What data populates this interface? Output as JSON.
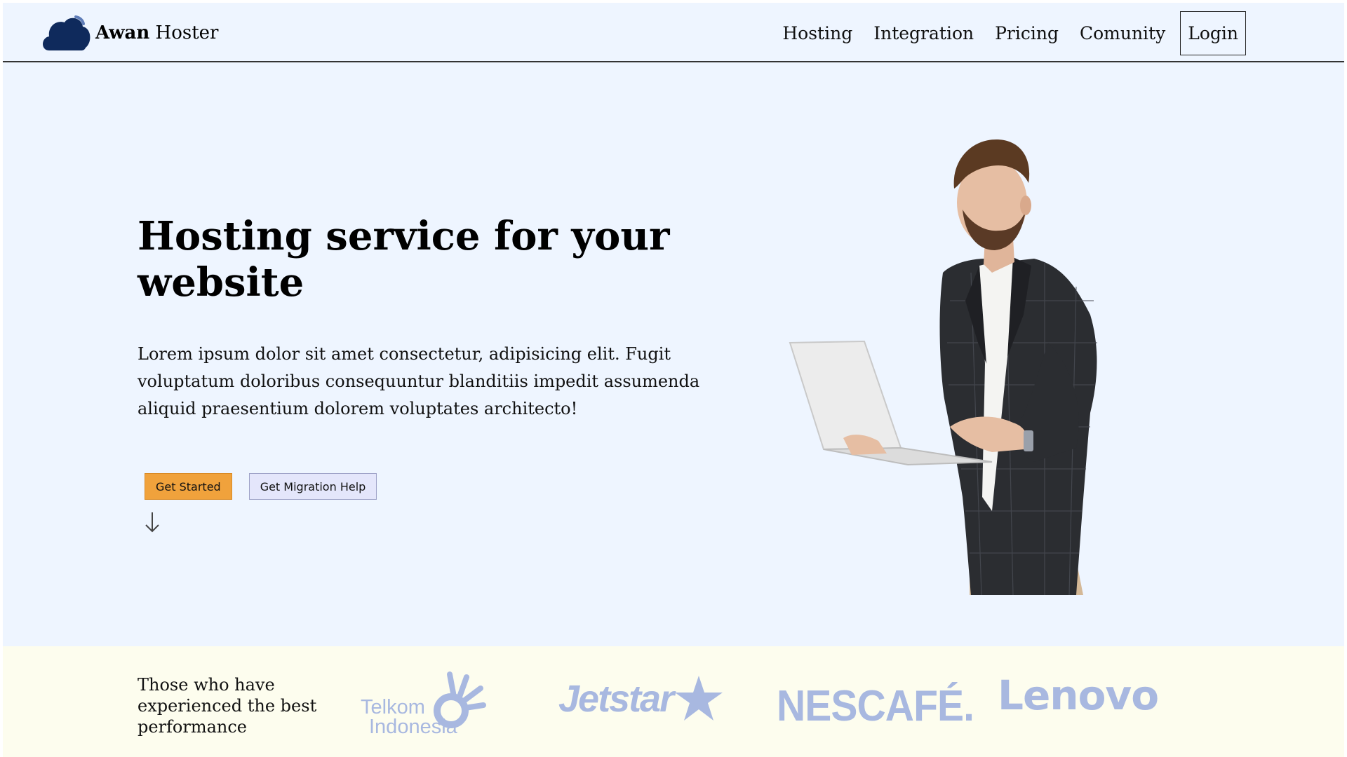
{
  "brand": {
    "name_bold": "Awan",
    "name_rest": "Hoster",
    "logo_icon": "cloud-icon",
    "logo_color": "#0f2a5c"
  },
  "nav": {
    "links": [
      {
        "label": "Hosting"
      },
      {
        "label": "Integration"
      },
      {
        "label": "Pricing"
      },
      {
        "label": "Comunity"
      }
    ],
    "login_label": "Login"
  },
  "hero": {
    "title": "Hosting service for your website",
    "description": "Lorem ipsum dolor sit amet consectetur, adipisicing elit. Fugit voluptatum doloribus consequuntur blanditiis impedit assumenda aliquid praesentium dolorem voluptates architecto!",
    "primary_button": "Get Started",
    "secondary_button": "Get Migration Help",
    "scroll_icon": "arrow-down-icon",
    "image_subject": "man-with-laptop-photo"
  },
  "partners": {
    "heading": "Those who have experienced the best performance",
    "logos": [
      {
        "name": "Telkom Indonesia",
        "line1": "Telkom",
        "line2": "Indonesia"
      },
      {
        "name": "Jetstar",
        "text": "Jetstar"
      },
      {
        "name": "Nescafe",
        "text": "NESCAFÉ."
      },
      {
        "name": "Lenovo",
        "text": "Lenovo"
      }
    ]
  },
  "colors": {
    "page_background": "#eef5ff",
    "partners_background": "#fdfdee",
    "primary_button": "#f0a23c",
    "secondary_button": "#e4e6fb",
    "partner_logo": "#a8b8e0"
  }
}
